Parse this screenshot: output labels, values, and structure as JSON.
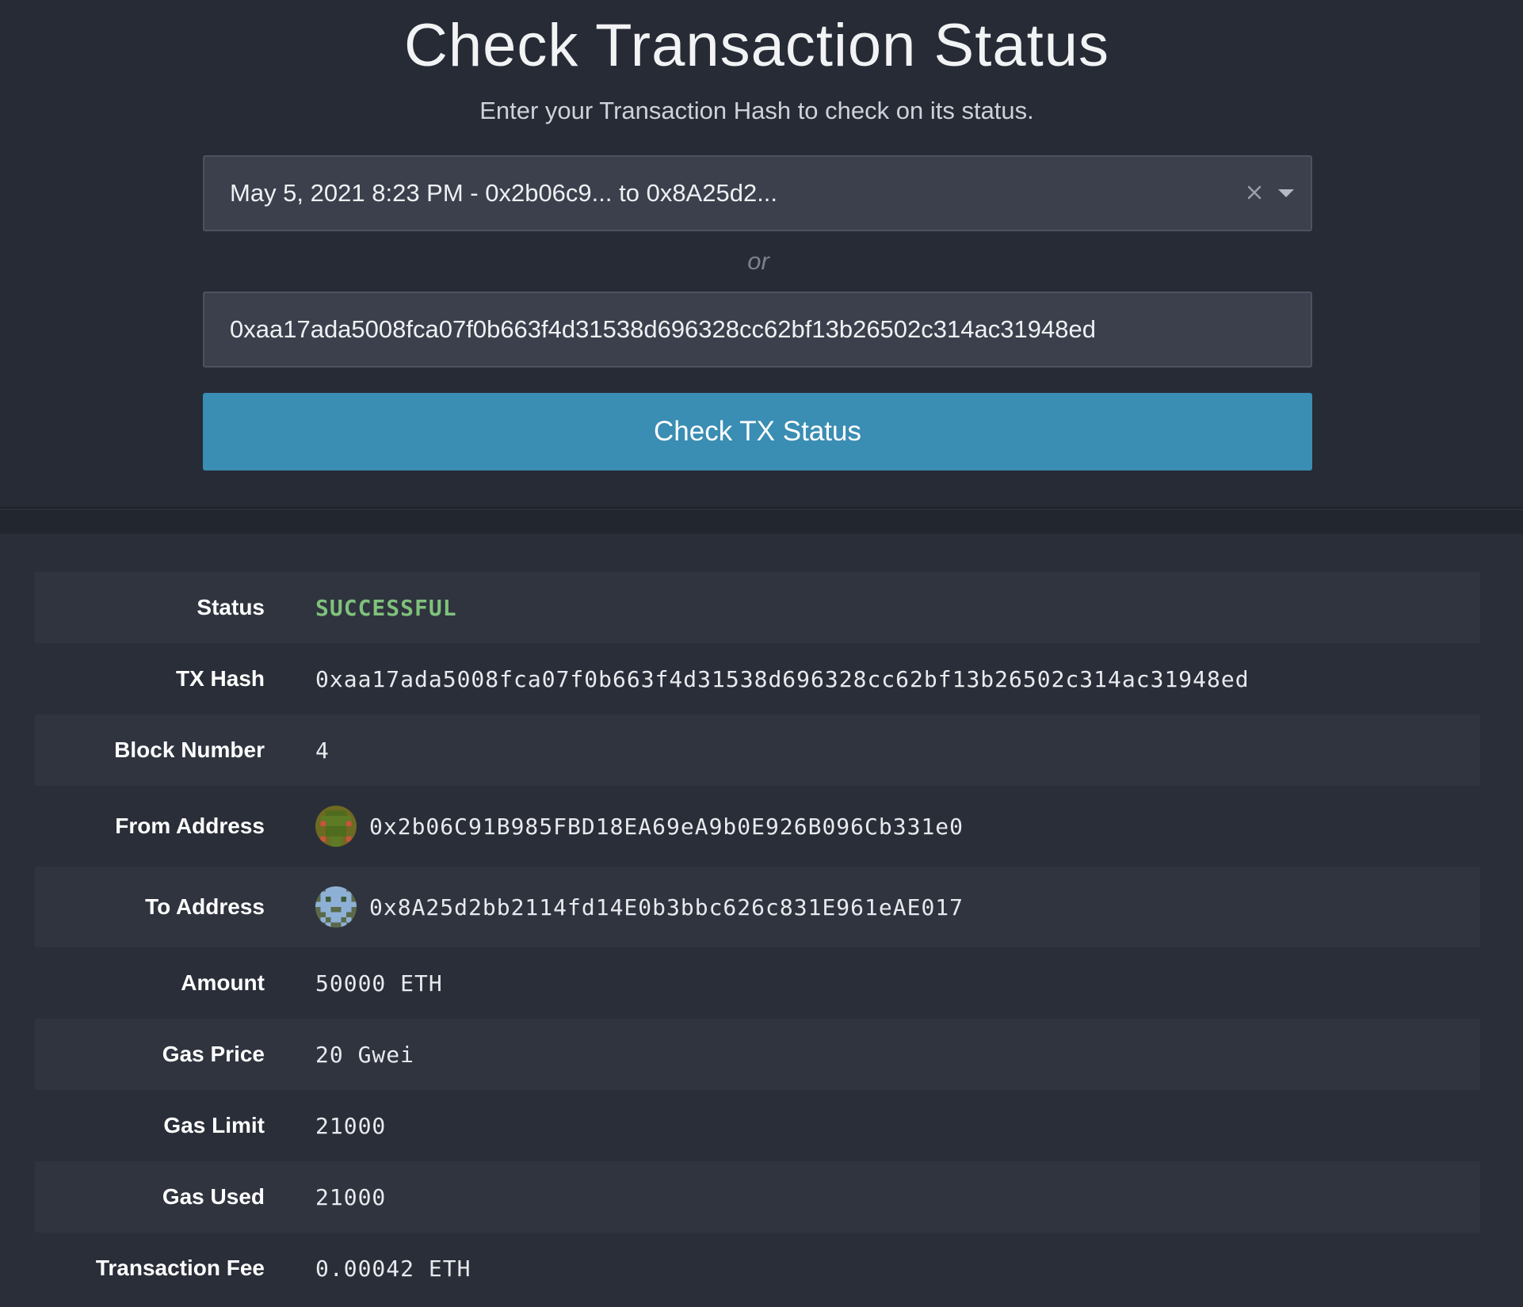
{
  "header": {
    "title": "Check Transaction Status",
    "subtitle": "Enter your Transaction Hash to check on its status."
  },
  "form": {
    "selected_transaction": "May 5, 2021 8:23 PM - 0x2b06c9... to 0x8A25d2...",
    "or_label": "or",
    "hash_input_value": "0xaa17ada5008fca07f0b663f4d31538d696328cc62bf13b26502c314ac31948ed",
    "check_button_label": "Check TX Status"
  },
  "details": {
    "status_label": "Status",
    "status_value": "SUCCESSFUL",
    "status_color": "#7fc27b",
    "tx_hash_label": "TX Hash",
    "tx_hash_value": "0xaa17ada5008fca07f0b663f4d31538d696328cc62bf13b26502c314ac31948ed",
    "block_number_label": "Block Number",
    "block_number_value": "4",
    "from_address_label": "From Address",
    "from_address_value": "0x2b06C91B985FBD18EA69eA9b0E926B096Cb331e0",
    "to_address_label": "To Address",
    "to_address_value": "0x8A25d2bb2114fd14E0b3bbc626c831E961eAE017",
    "amount_label": "Amount",
    "amount_value": "50000 ETH",
    "gas_price_label": "Gas Price",
    "gas_price_value": "20 Gwei",
    "gas_limit_label": "Gas Limit",
    "gas_limit_value": "21000",
    "gas_used_label": "Gas Used",
    "gas_used_value": "21000",
    "transaction_fee_label": "Transaction Fee",
    "transaction_fee_value": "0.00042 ETH"
  },
  "colors": {
    "accent": "#3a8db3",
    "background": "#2a2e38",
    "success": "#7fc27b"
  },
  "icons": {
    "clear": "close-icon",
    "dropdown": "chevron-down-icon",
    "from_avatar": "from-identicon",
    "to_avatar": "to-identicon"
  }
}
